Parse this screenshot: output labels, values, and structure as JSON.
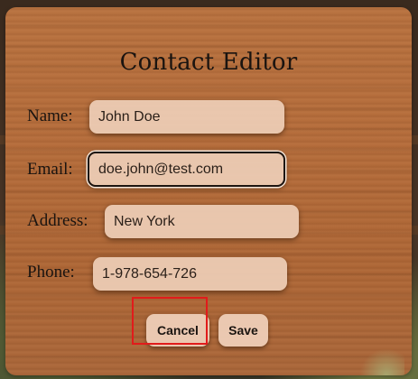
{
  "dialog": {
    "title": "Contact Editor"
  },
  "fields": {
    "name": {
      "label": "Name:",
      "value": "John Doe"
    },
    "email": {
      "label": "Email:",
      "value": "doe.john@test.com"
    },
    "address": {
      "label": "Address:",
      "value": "New York"
    },
    "phone": {
      "label": "Phone:",
      "value": "1-978-654-726"
    }
  },
  "buttons": {
    "cancel": "Cancel",
    "save": "Save"
  },
  "colors": {
    "highlight_border": "#e11b1b",
    "panel_wood": "#b46c3b",
    "input_bg": "#eeceb7"
  }
}
